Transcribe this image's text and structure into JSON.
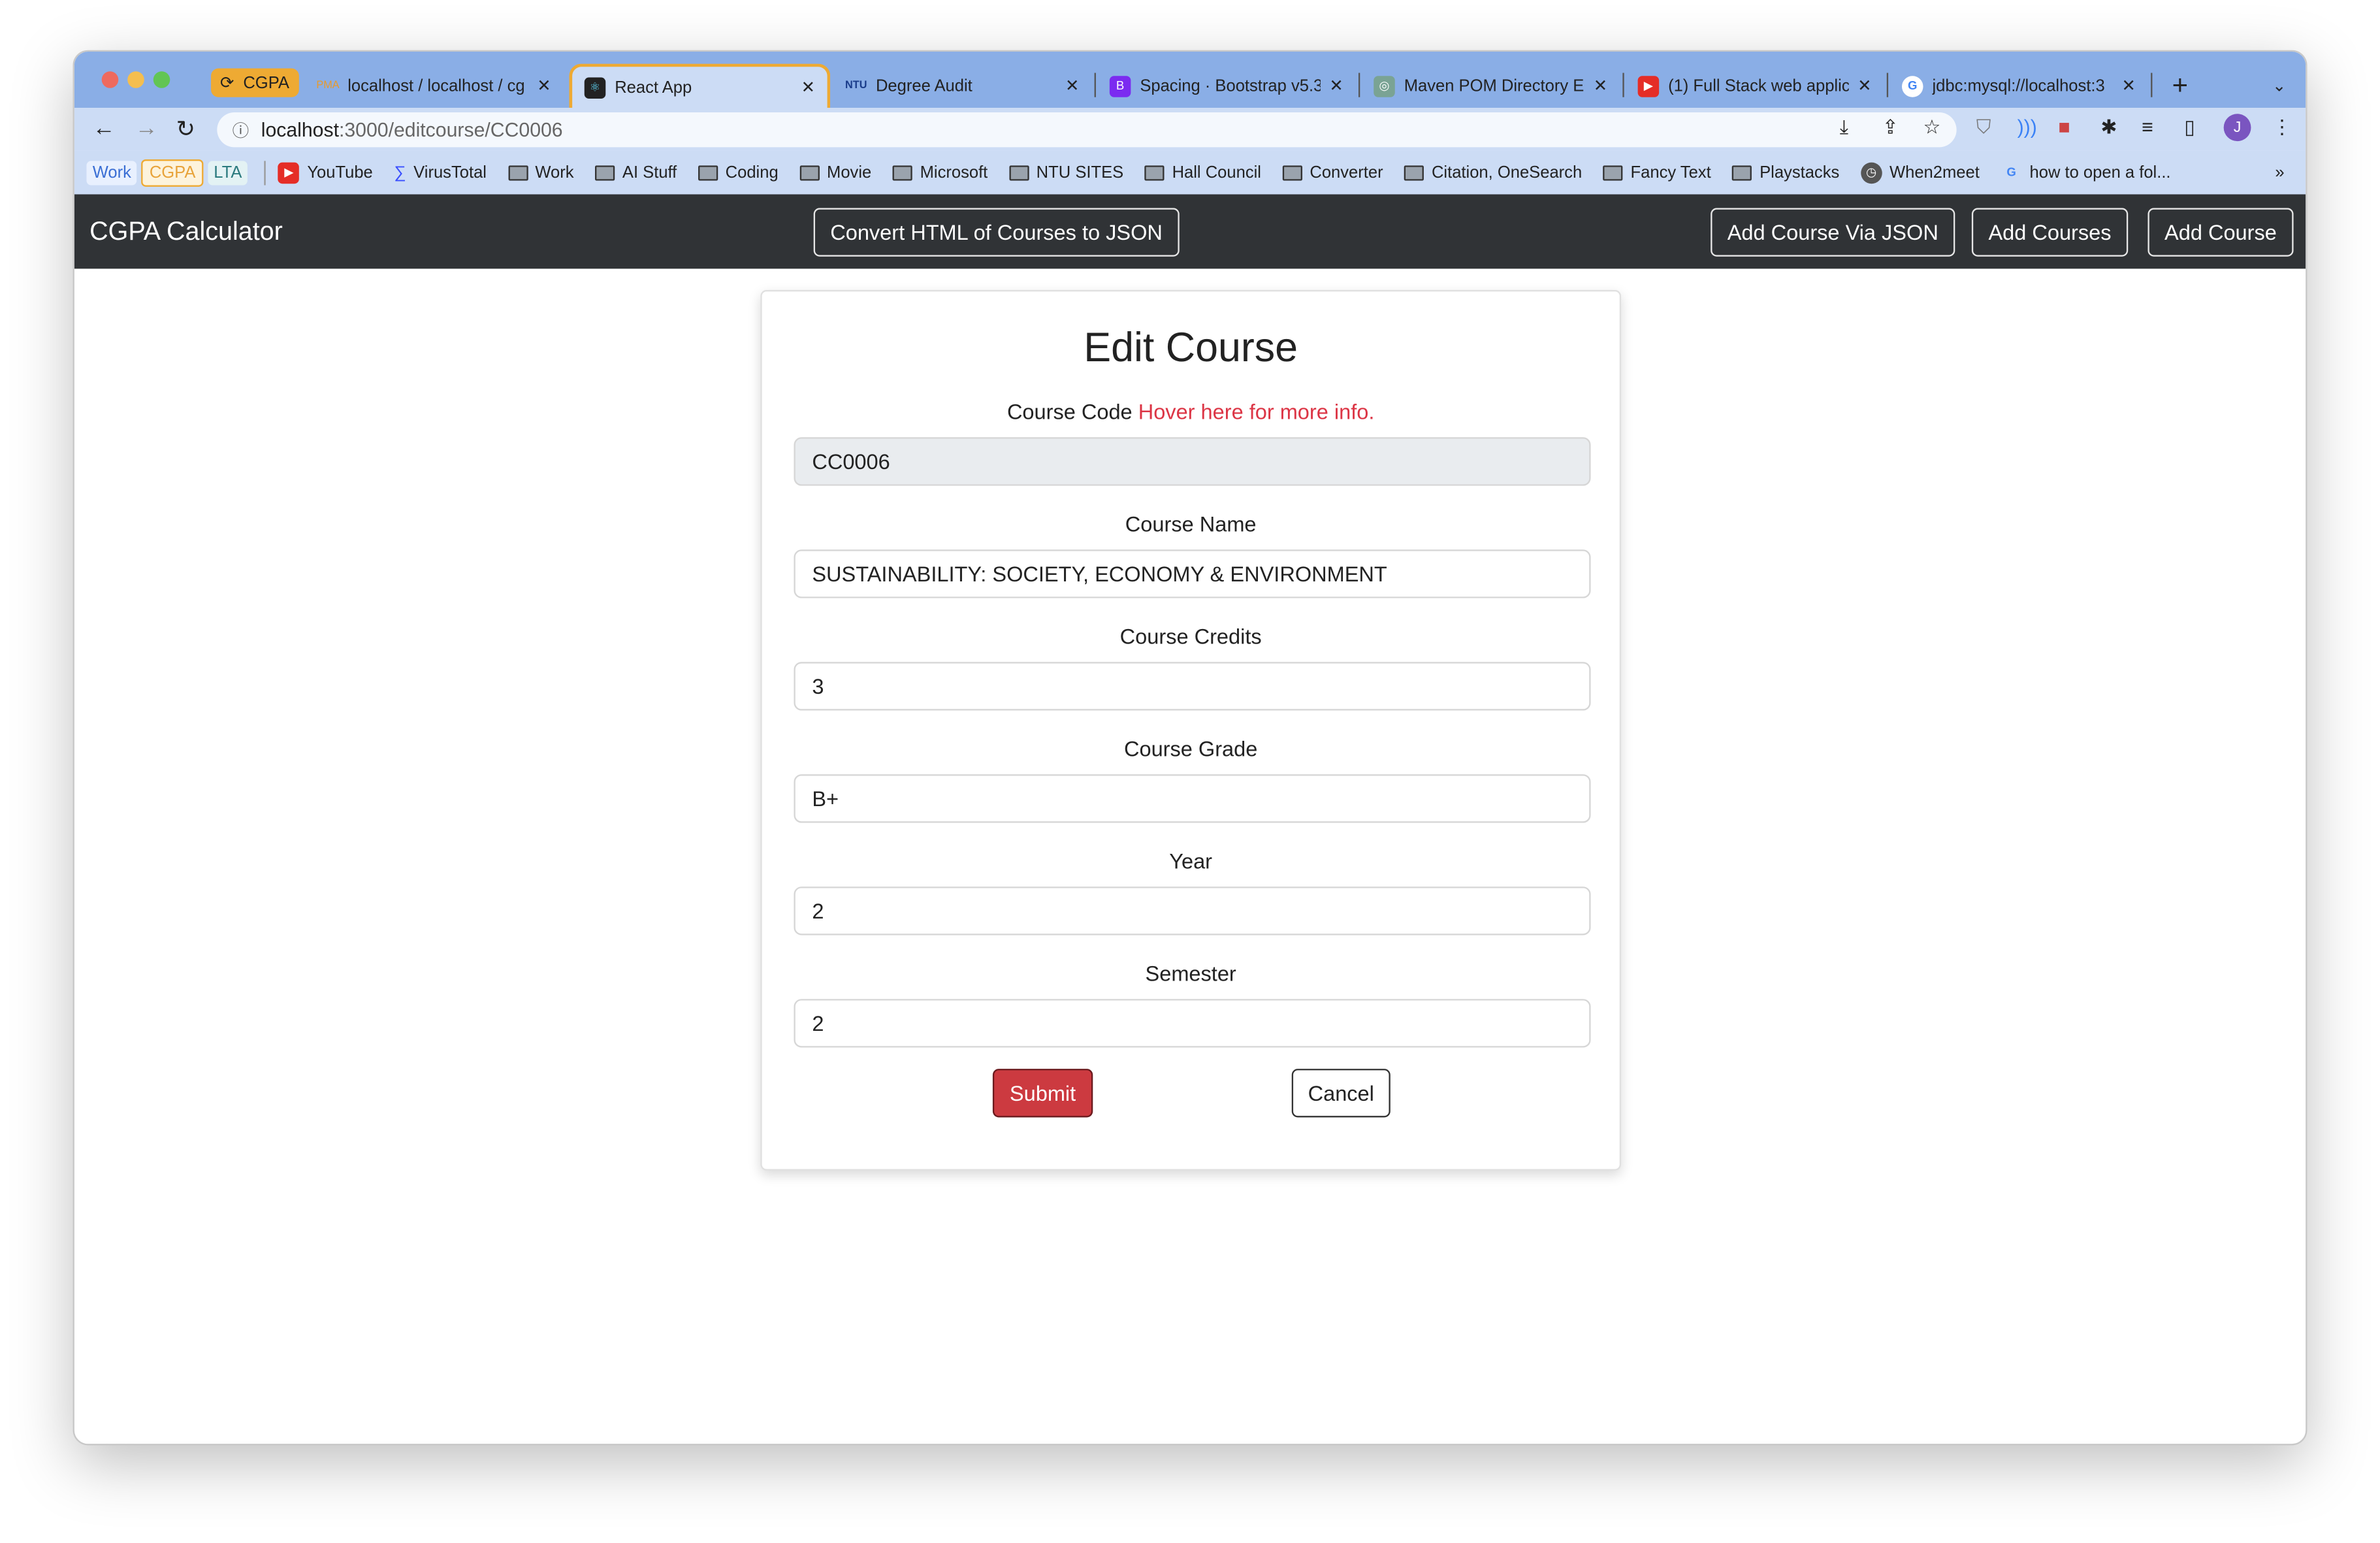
{
  "browser": {
    "tabs": [
      {
        "label": "CGPA",
        "pinned": true
      },
      {
        "label": "localhost / localhost / cg"
      },
      {
        "label": "React App",
        "active": true
      },
      {
        "label": "Degree Audit"
      },
      {
        "label": "Spacing · Bootstrap v5.3"
      },
      {
        "label": "Maven POM Directory Er"
      },
      {
        "label": "(1) Full Stack web applic"
      },
      {
        "label": "jdbc:mysql://localhost:3"
      }
    ],
    "url_host": "localhost",
    "url_rest": ":3000/editcourse/CC0006",
    "bookmarks_chips": [
      "Work",
      "CGPA",
      "LTA"
    ],
    "bookmarks": [
      {
        "label": "YouTube",
        "icon": "youtube-icon"
      },
      {
        "label": "VirusTotal",
        "icon": "virustotal-icon"
      },
      {
        "label": "Work",
        "icon": "folder-icon"
      },
      {
        "label": "AI Stuff",
        "icon": "folder-icon"
      },
      {
        "label": "Coding",
        "icon": "folder-icon"
      },
      {
        "label": "Movie",
        "icon": "folder-icon"
      },
      {
        "label": "Microsoft",
        "icon": "folder-icon"
      },
      {
        "label": "NTU SITES",
        "icon": "folder-icon"
      },
      {
        "label": "Hall Council",
        "icon": "folder-icon"
      },
      {
        "label": "Converter",
        "icon": "folder-icon"
      },
      {
        "label": "Citation, OneSearch",
        "icon": "folder-icon"
      },
      {
        "label": "Fancy Text",
        "icon": "folder-icon"
      },
      {
        "label": "Playstacks",
        "icon": "folder-icon"
      },
      {
        "label": "When2meet",
        "icon": "clock-icon"
      },
      {
        "label": "how to open a fol...",
        "icon": "google-icon"
      }
    ],
    "profile_initial": "J"
  },
  "navbar": {
    "brand": "CGPA Calculator",
    "convert": "Convert HTML of Courses to JSON",
    "add_json": "Add Course Via JSON",
    "add_courses": "Add Courses",
    "add_course": "Add Course"
  },
  "form": {
    "title": "Edit Course",
    "code_label": "Course Code",
    "code_hint": "Hover here for more info.",
    "code": "CC0006",
    "name_label": "Course Name",
    "name": "SUSTAINABILITY: SOCIETY, ECONOMY & ENVIRONMENT",
    "credits_label": "Course Credits",
    "credits": "3",
    "grade_label": "Course Grade",
    "grade": "B+",
    "year_label": "Year",
    "year": "2",
    "sem_label": "Semester",
    "sem": "2",
    "submit": "Submit",
    "cancel": "Cancel"
  },
  "colors": {
    "danger": "#dc3545",
    "navbar": "#303336",
    "tabbar": "#8aaee6"
  }
}
